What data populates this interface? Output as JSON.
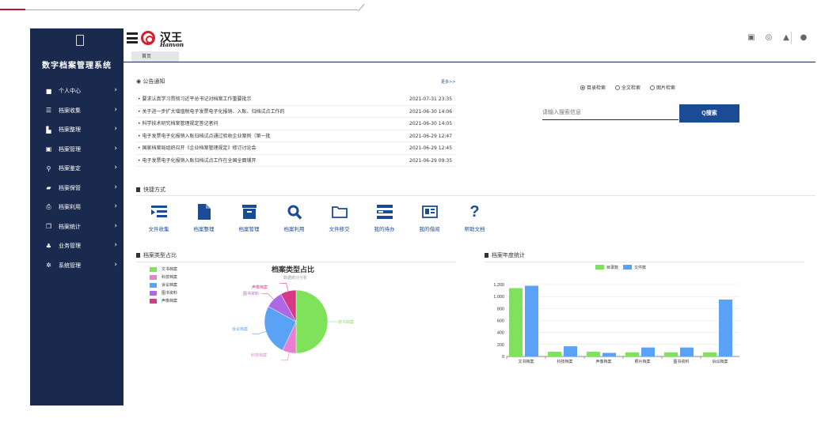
{
  "app": {
    "title": "数字档案管理系统",
    "brand_cn": "汉王",
    "brand_en": "Hanvon"
  },
  "sidebar": {
    "items": [
      {
        "label": "个人中心",
        "icon": "user-card-icon"
      },
      {
        "label": "档案收集",
        "icon": "list-collect-icon"
      },
      {
        "label": "档案整理",
        "icon": "file-icon"
      },
      {
        "label": "档案管理",
        "icon": "archive-box-icon"
      },
      {
        "label": "档案鉴定",
        "icon": "search-icon"
      },
      {
        "label": "档案保管",
        "icon": "briefcase-icon"
      },
      {
        "label": "档案利用",
        "icon": "printer-icon"
      },
      {
        "label": "档案统计",
        "icon": "copy-icon"
      },
      {
        "label": "业务管理",
        "icon": "org-chart-icon"
      },
      {
        "label": "系统管理",
        "icon": "gear-icon"
      }
    ]
  },
  "tabs": [
    {
      "label": "首页"
    }
  ],
  "notice": {
    "title": "公告通知",
    "more": "更多>>",
    "rows": [
      {
        "text": "要求认真学习贯彻习近平总书记对档案工作重要批示",
        "date": "2021-07-31 23:35"
      },
      {
        "text": "关于进一步扩大增值税电子发票电子化报销、入账、归档试点工作的",
        "date": "2021-06-30 14:06"
      },
      {
        "text": "科学技术研究档案管理规定答记者问",
        "date": "2021-06-30 14:05"
      },
      {
        "text": "电子发票电子化报销入账归档试点通过验收企业案例（第一批",
        "date": "2021-06-29 12:47"
      },
      {
        "text": "国家档案局组织召开《企业档案管理规定》修订讨论会",
        "date": "2021-06-29 12:45"
      },
      {
        "text": "电子发票电子化报销入账归档试点工作在全国全面铺开",
        "date": "2021-06-29 09:35"
      }
    ]
  },
  "search": {
    "options": [
      "目录检索",
      "全文检索",
      "图片检索"
    ],
    "selected": "目录检索",
    "placeholder": "请输入搜索信息",
    "button": "Q搜索"
  },
  "quick": {
    "title": "快捷方式",
    "items": [
      {
        "label": "文件收集",
        "icon": "list-indent-icon"
      },
      {
        "label": "档案整理",
        "icon": "file-icon"
      },
      {
        "label": "档案管理",
        "icon": "archive-box-icon"
      },
      {
        "label": "档案利用",
        "icon": "search-icon"
      },
      {
        "label": "文件移交",
        "icon": "folder-icon"
      },
      {
        "label": "我的待办",
        "icon": "server-list-icon"
      },
      {
        "label": "我的借阅",
        "icon": "id-card-icon"
      },
      {
        "label": "帮助文档",
        "icon": "question-icon"
      }
    ]
  },
  "pie_section": {
    "title": "档案类型占比"
  },
  "bar_section": {
    "title": "档案年度统计"
  },
  "chart_data": [
    {
      "type": "pie",
      "title": "档案类型占比",
      "subtitle": "数据统计分析",
      "categories": [
        "文书档案",
        "科技档案",
        "诉讼档案",
        "图书资料",
        "声像档案"
      ],
      "values": [
        50,
        7,
        26,
        9,
        8
      ],
      "colors": [
        "#7ee35b",
        "#e97ed2",
        "#5aa2f5",
        "#b067e6",
        "#d63a86"
      ],
      "legend": "top-left"
    },
    {
      "type": "bar",
      "categories": [
        "文书档案",
        "科技档案",
        "声像档案",
        "照片档案",
        "图书资料",
        "诉讼档案"
      ],
      "series": [
        {
          "name": "目录数",
          "values": [
            1140,
            80,
            80,
            70,
            70,
            70
          ],
          "color": "#7ee35b"
        },
        {
          "name": "文件数",
          "values": [
            1180,
            170,
            60,
            150,
            150,
            950
          ],
          "color": "#5aa2f5"
        }
      ],
      "ylim": [
        0,
        1200
      ],
      "yticks": [
        "0",
        "200",
        "400",
        "600",
        "800",
        "1,000",
        "1,200"
      ],
      "legend": "top",
      "grid": true
    }
  ]
}
